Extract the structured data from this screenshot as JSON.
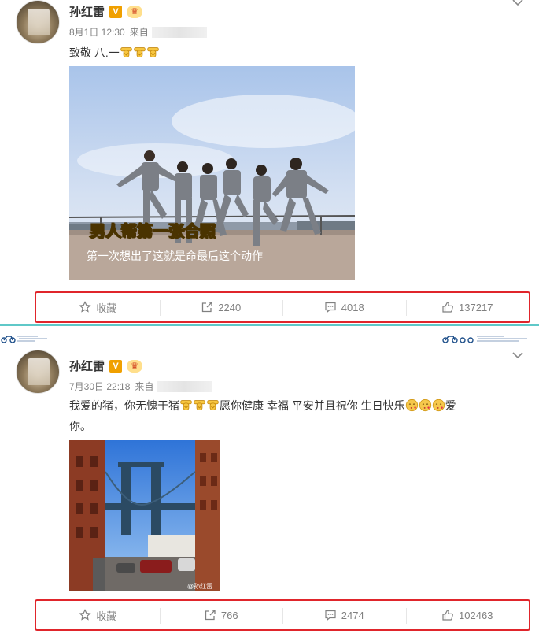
{
  "posts": [
    {
      "username": "孙红雷",
      "verified_badge": "V",
      "vip_badge": "♛",
      "time": "8月1日 12:30",
      "source_prefix": "来自",
      "text": "致敬 八.一",
      "text_emoji": [
        "salute-emoji",
        "salute-emoji",
        "salute-emoji"
      ],
      "image": {
        "subject": "group-photo-six-men",
        "caption_main": "男人帮第一张合照",
        "caption_sub": "第一次想出了这就是命最后这个动作"
      },
      "actions": {
        "favorite": "收藏",
        "repost": "2240",
        "comment": "4018",
        "like": "137217"
      }
    },
    {
      "username": "孙红雷",
      "verified_badge": "V",
      "vip_badge": "♛",
      "time": "7月30日 22:18",
      "source_prefix": "来自",
      "text_part1": "我爱的猪，你无愧于猪",
      "text_part2": "愿你健康 幸福 平安并且祝你 生日快乐",
      "text_part3": "爱",
      "text_part4": "你。",
      "image": {
        "subject": "manhattan-bridge-street",
        "watermark": "@孙红雷"
      },
      "actions": {
        "favorite": "收藏",
        "repost": "766",
        "comment": "2474",
        "like": "102463"
      }
    }
  ],
  "colors": {
    "highlight_border": "#e0252b",
    "divider_accent": "#5fc8c8",
    "muted_text": "#808080",
    "badge_orange": "#f0a000"
  },
  "icons": [
    "star-icon",
    "share-icon",
    "comment-icon",
    "thumbs-up-icon",
    "chevron-down-icon"
  ]
}
